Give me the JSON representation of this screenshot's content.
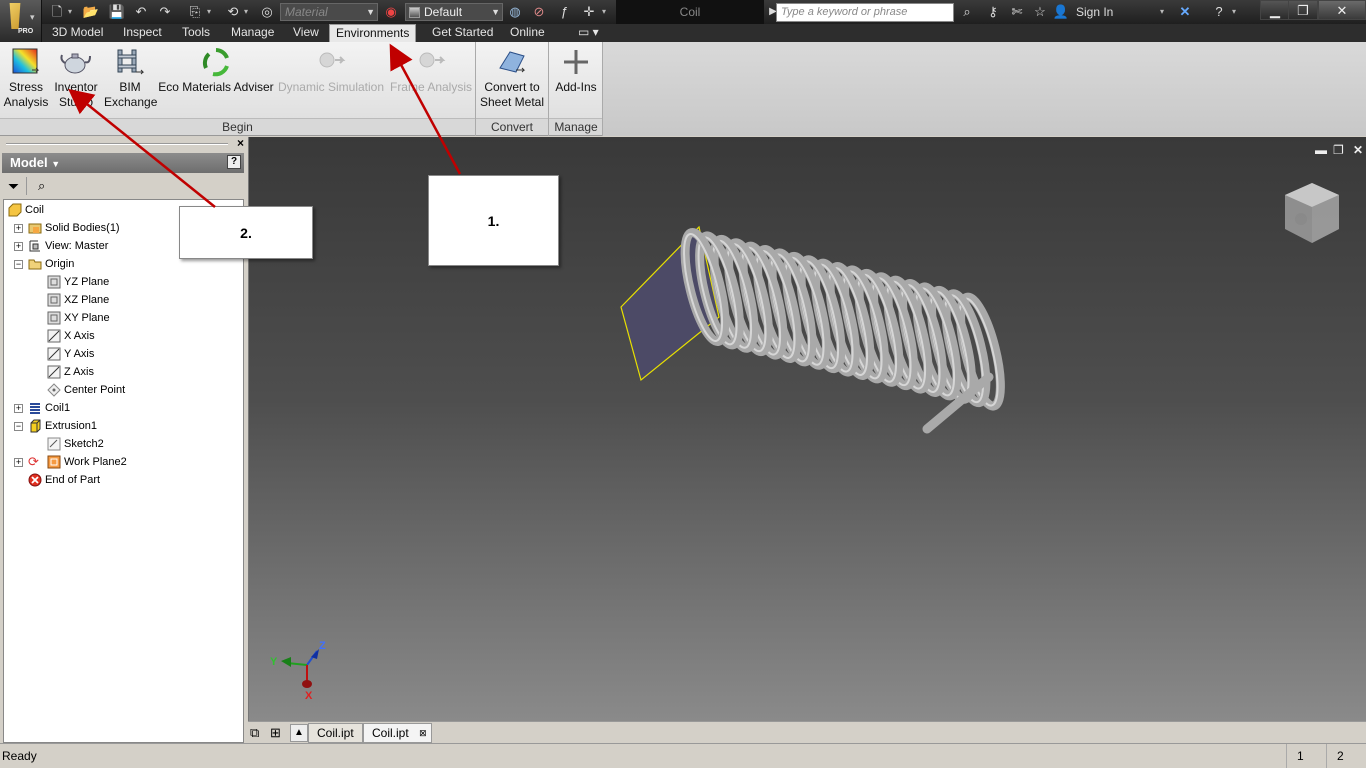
{
  "app": {
    "badge": "PRO",
    "document_title": "Coil",
    "material_placeholder": "Material",
    "appearance_value": "Default",
    "search_placeholder": "Type a keyword or phrase",
    "sign_in": "Sign In"
  },
  "tabs": [
    "3D Model",
    "Inspect",
    "Tools",
    "Manage",
    "View",
    "Environments",
    "Get Started",
    "Online"
  ],
  "active_tab": "Environments",
  "ribbon": {
    "begin": {
      "label": "Begin",
      "buttons": [
        {
          "line1": "Stress",
          "line2": "Analysis",
          "icon": "stress-analysis-icon"
        },
        {
          "line1": "Inventor",
          "line2": "Studio",
          "icon": "teapot-icon"
        },
        {
          "line1": "BIM",
          "line2": "Exchange",
          "icon": "bim-exchange-icon"
        },
        {
          "line1": "Eco Materials Adviser",
          "line2": "",
          "icon": "eco-recycle-icon"
        },
        {
          "line1": "Dynamic Simulation",
          "line2": "",
          "icon": "dynamic-simulation-icon",
          "disabled": true
        },
        {
          "line1": "Frame Analysis",
          "line2": "",
          "icon": "frame-analysis-icon",
          "disabled": true
        }
      ]
    },
    "convert": {
      "label": "Convert",
      "button": {
        "line1": "Convert to",
        "line2": "Sheet Metal",
        "icon": "sheet-metal-icon"
      }
    },
    "manage": {
      "label": "Manage",
      "button": {
        "line1": "Add-Ins",
        "line2": "",
        "icon": "plus-icon"
      }
    }
  },
  "browser": {
    "title": "Model",
    "tree": [
      {
        "label": "Coil",
        "icon": "part-icon"
      },
      {
        "label": "Solid Bodies(1)",
        "icon": "folder-icon",
        "expandable": true
      },
      {
        "label": "View: Master",
        "icon": "view-icon",
        "expandable": true
      },
      {
        "label": "Origin",
        "icon": "folder-open-icon",
        "expandable": true,
        "expanded": true
      },
      {
        "label": "YZ Plane",
        "icon": "plane-icon"
      },
      {
        "label": "XZ Plane",
        "icon": "plane-icon"
      },
      {
        "label": "XY Plane",
        "icon": "plane-icon"
      },
      {
        "label": "X Axis",
        "icon": "axis-icon"
      },
      {
        "label": "Y Axis",
        "icon": "axis-icon"
      },
      {
        "label": "Z Axis",
        "icon": "axis-icon"
      },
      {
        "label": "Center Point",
        "icon": "point-icon"
      },
      {
        "label": "Coil1",
        "icon": "coil-icon",
        "expandable": true
      },
      {
        "label": "Extrusion1",
        "icon": "extrusion-icon",
        "expandable": true,
        "expanded": true
      },
      {
        "label": "Sketch2",
        "icon": "sketch-icon"
      },
      {
        "label": "Work Plane2",
        "icon": "work-plane-icon",
        "expandable": true
      },
      {
        "label": "End of Part",
        "icon": "end-of-part-icon"
      }
    ]
  },
  "viewport": {
    "triad": {
      "x": "X",
      "y": "Y",
      "z": "Z"
    }
  },
  "document_tabs": [
    "Coil.ipt",
    "Coil.ipt"
  ],
  "status": {
    "text": "Ready",
    "count1": "1",
    "count2": "2"
  },
  "annotations": {
    "callout1": "1.",
    "callout2": "2."
  },
  "colors": {
    "annotation_arrow": "#c00000",
    "plane_outline": "#e8e000",
    "accent_tab": "#e8e8e8"
  }
}
